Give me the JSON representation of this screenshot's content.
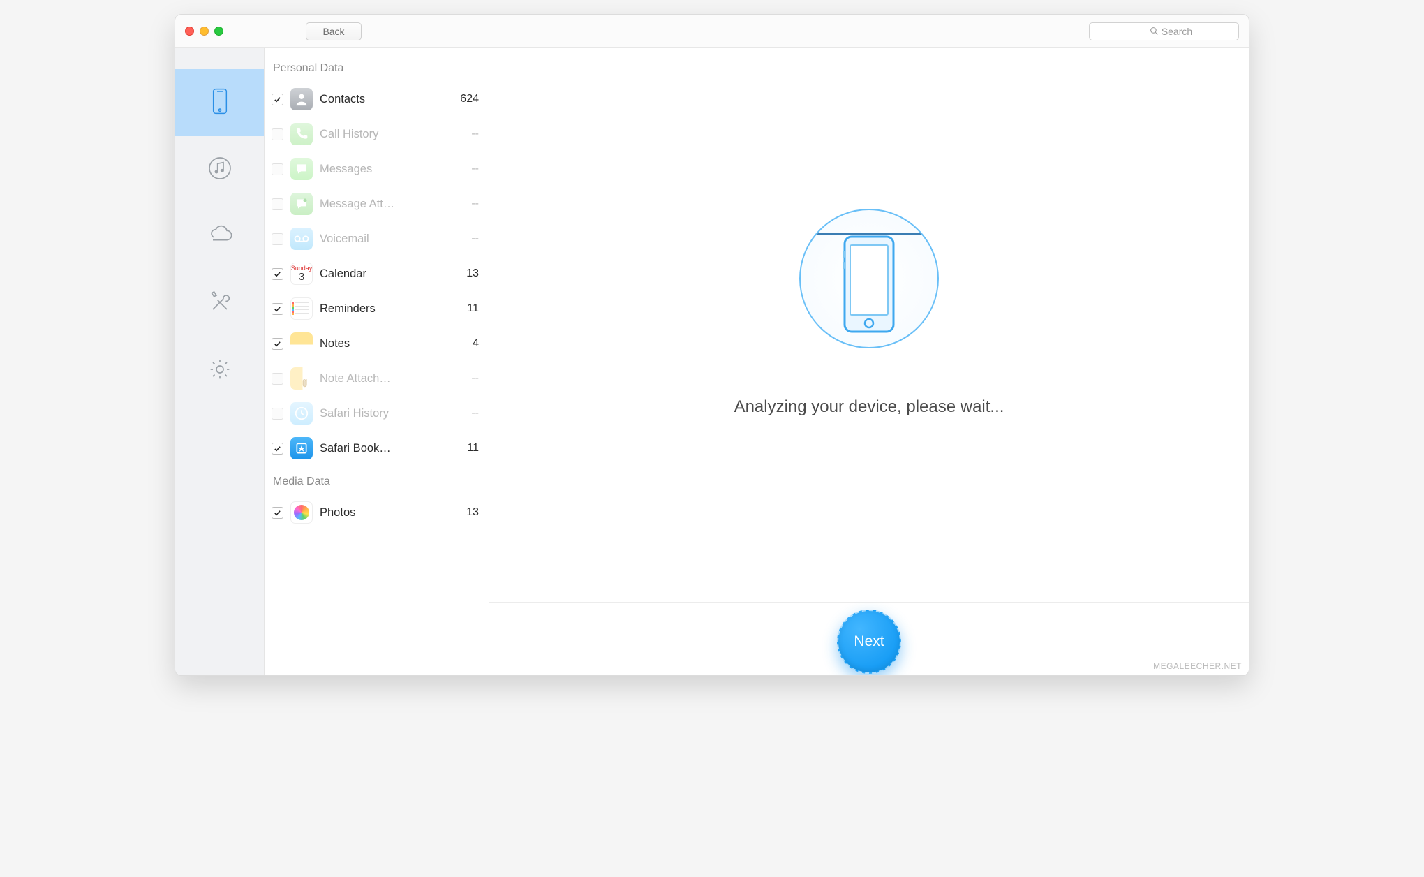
{
  "header": {
    "back_label": "Back",
    "search_placeholder": "Search"
  },
  "sidebar": {
    "items": [
      {
        "key": "device",
        "icon": "phone-icon",
        "active": true
      },
      {
        "key": "music",
        "icon": "music-icon",
        "active": false
      },
      {
        "key": "cloud",
        "icon": "cloud-icon",
        "active": false
      },
      {
        "key": "tools",
        "icon": "tools-icon",
        "active": false
      },
      {
        "key": "settings",
        "icon": "gear-icon",
        "active": false
      }
    ]
  },
  "list": {
    "sections": [
      {
        "title": "Personal Data",
        "items": [
          {
            "id": "contacts",
            "label": "Contacts",
            "count": "624",
            "checked": true,
            "enabled": true,
            "icon_class": "ic-contacts",
            "icon_name": "contacts-icon"
          },
          {
            "id": "call-history",
            "label": "Call History",
            "count": "--",
            "checked": false,
            "enabled": false,
            "icon_class": "ic-call",
            "icon_name": "phone-handset-icon"
          },
          {
            "id": "messages",
            "label": "Messages",
            "count": "--",
            "checked": false,
            "enabled": false,
            "icon_class": "ic-msg",
            "icon_name": "message-bubble-icon"
          },
          {
            "id": "message-att",
            "label": "Message Att…",
            "count": "--",
            "checked": false,
            "enabled": false,
            "icon_class": "ic-msgatt",
            "icon_name": "message-attachment-icon"
          },
          {
            "id": "voicemail",
            "label": "Voicemail",
            "count": "--",
            "checked": false,
            "enabled": false,
            "icon_class": "ic-vm",
            "icon_name": "voicemail-icon"
          },
          {
            "id": "calendar",
            "label": "Calendar",
            "count": "13",
            "checked": true,
            "enabled": true,
            "icon_class": "ic-cal",
            "icon_name": "calendar-icon"
          },
          {
            "id": "reminders",
            "label": "Reminders",
            "count": "11",
            "checked": true,
            "enabled": true,
            "icon_class": "ic-rem",
            "icon_name": "reminders-icon"
          },
          {
            "id": "notes",
            "label": "Notes",
            "count": "4",
            "checked": true,
            "enabled": true,
            "icon_class": "ic-notes",
            "icon_name": "notes-icon"
          },
          {
            "id": "note-attach",
            "label": "Note Attach…",
            "count": "--",
            "checked": false,
            "enabled": false,
            "icon_class": "ic-noteatt",
            "icon_name": "note-attachment-icon"
          },
          {
            "id": "safari-history",
            "label": "Safari History",
            "count": "--",
            "checked": false,
            "enabled": false,
            "icon_class": "ic-safhist",
            "icon_name": "safari-history-icon"
          },
          {
            "id": "safari-bookmarks",
            "label": "Safari Book…",
            "count": "11",
            "checked": true,
            "enabled": true,
            "icon_class": "ic-safbook",
            "icon_name": "safari-bookmarks-icon"
          }
        ]
      },
      {
        "title": "Media Data",
        "items": [
          {
            "id": "photos",
            "label": "Photos",
            "count": "13",
            "checked": true,
            "enabled": true,
            "icon_class": "ic-photos",
            "icon_name": "photos-icon"
          }
        ]
      }
    ]
  },
  "main": {
    "status_text": "Analyzing your device, please wait..."
  },
  "footer": {
    "next_label": "Next"
  },
  "watermark": "MEGALEECHER.NET"
}
